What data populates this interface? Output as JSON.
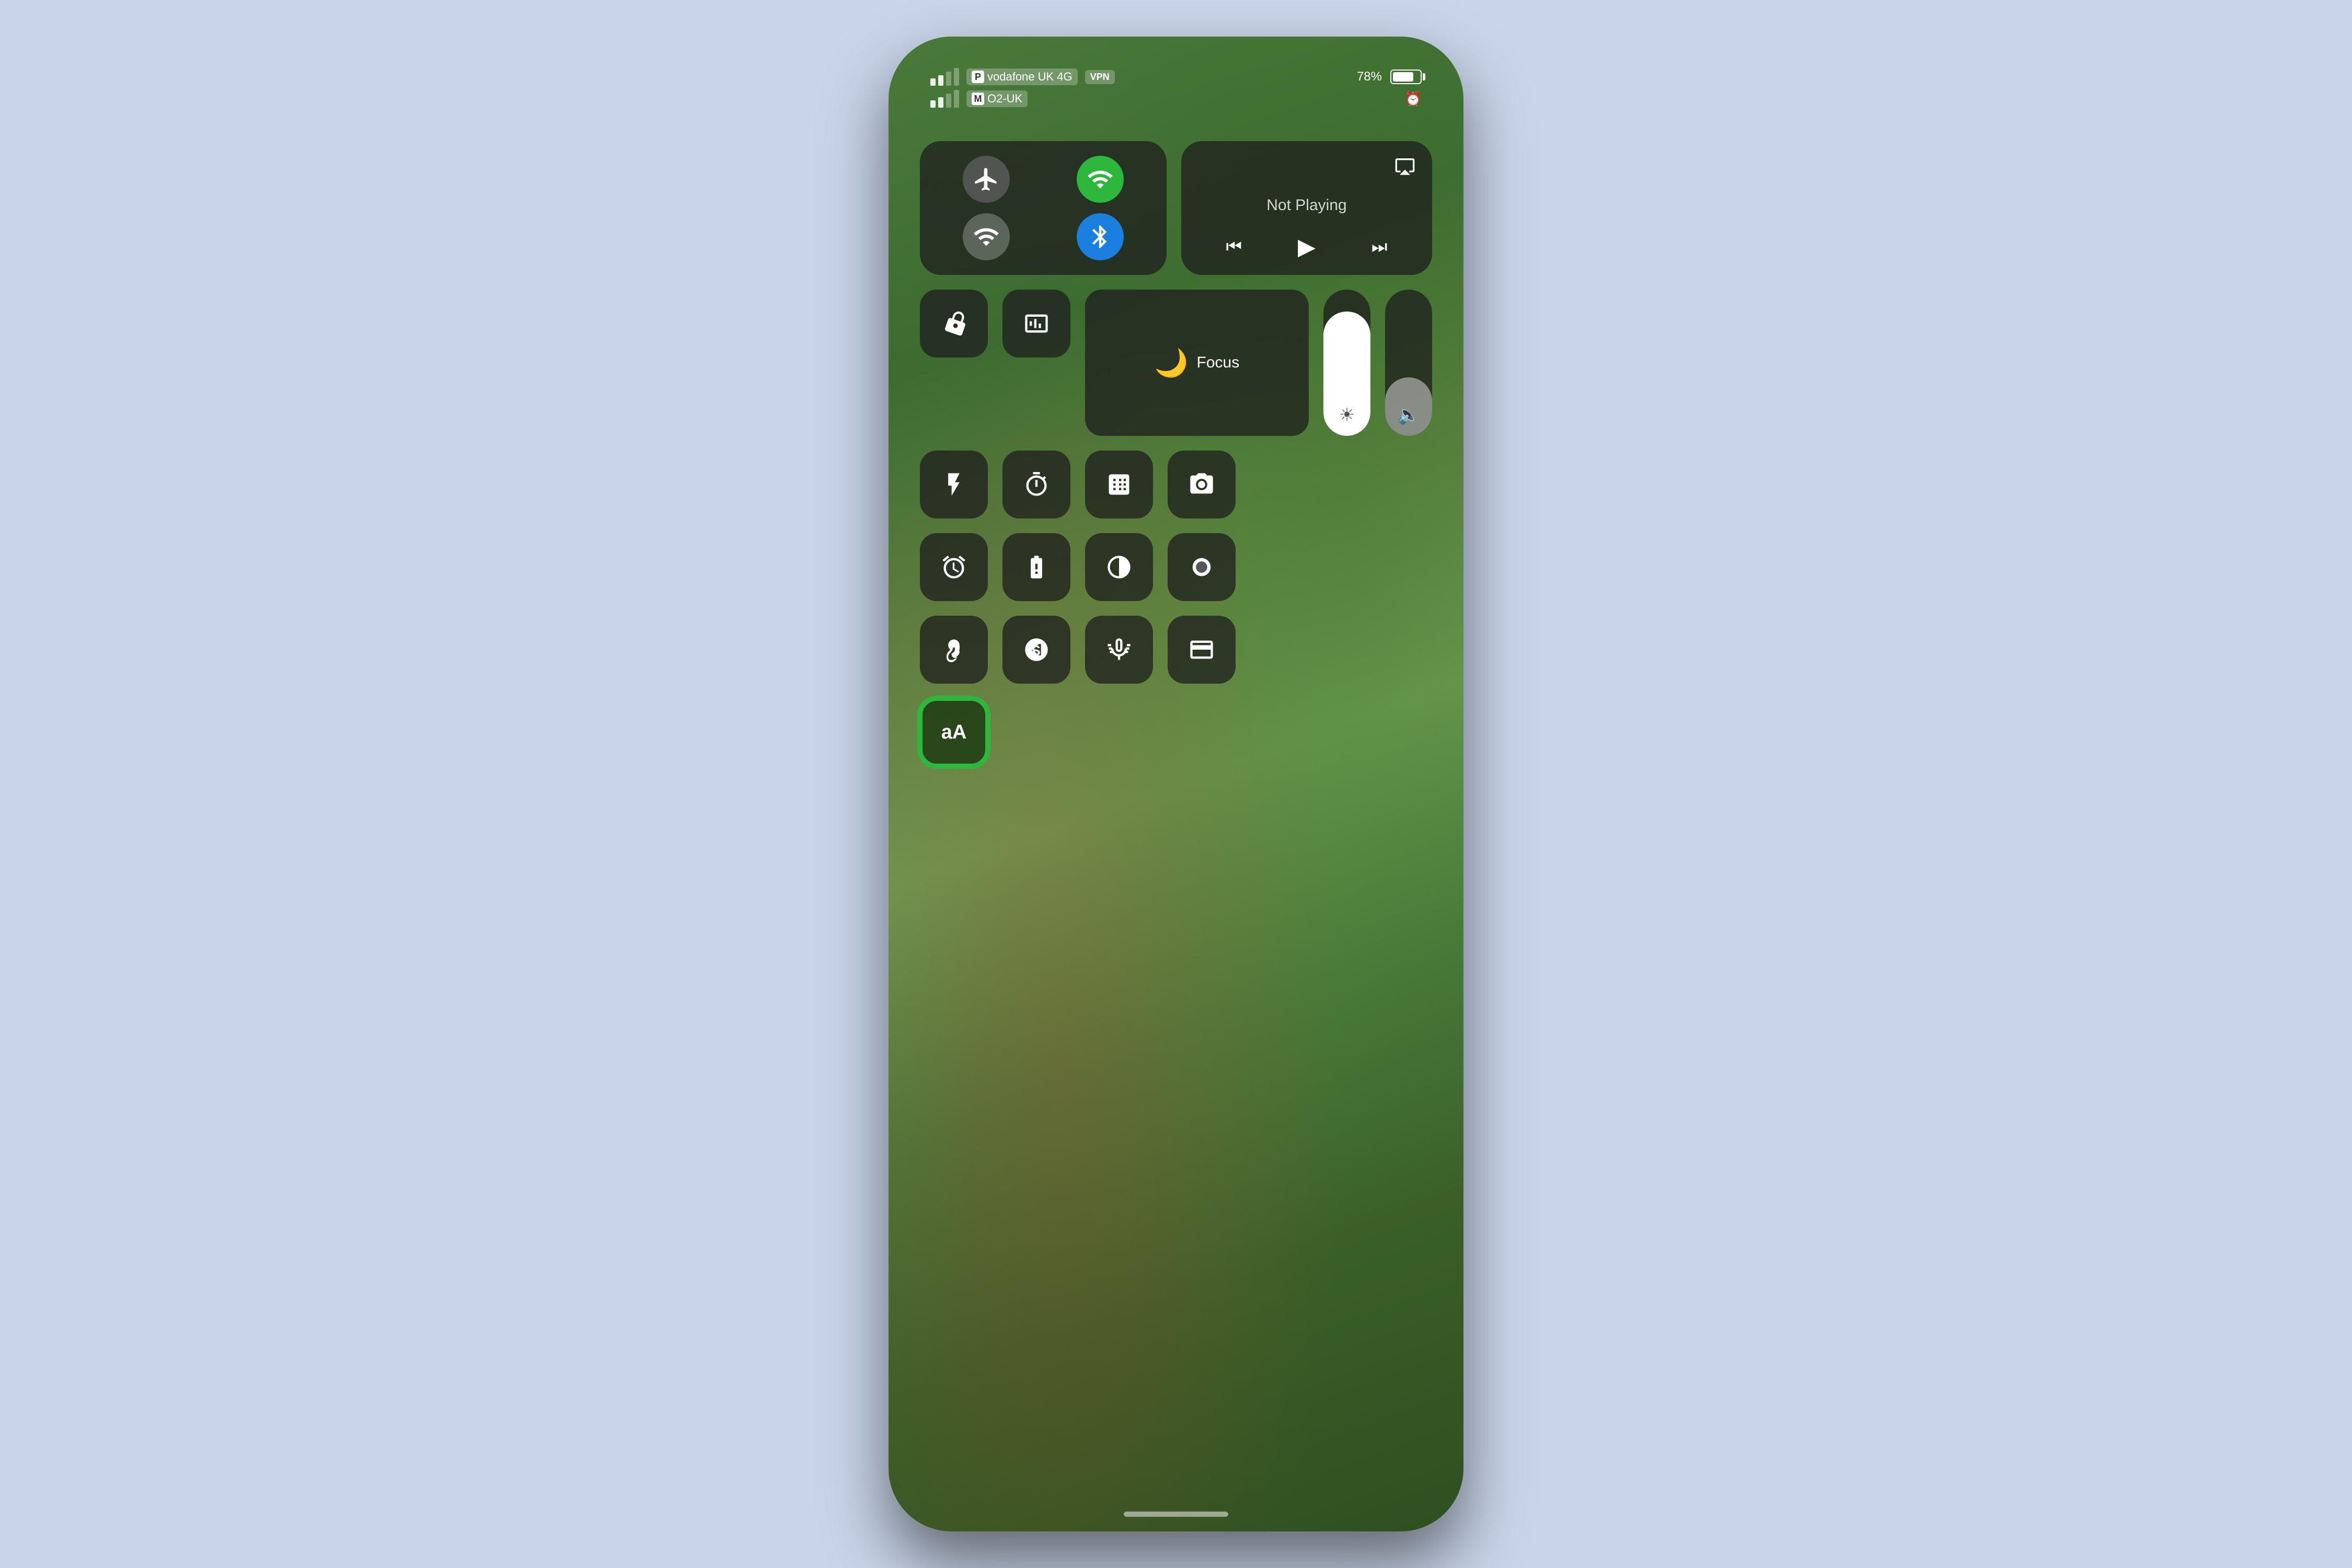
{
  "background_color": "#c8d4e8",
  "status_bar": {
    "row1": {
      "signal1_bars": [
        3,
        3
      ],
      "carrier1_letter": "P",
      "carrier1_name": "vodafone UK 4G",
      "vpn_label": "VPN",
      "battery_pct": "78%",
      "battery_level": 78
    },
    "row2": {
      "carrier2_letter": "M",
      "carrier2_name": "O2-UK",
      "alarm_icon": "⏰"
    }
  },
  "connectivity": {
    "airplane_mode": false,
    "cellular_active": true,
    "wifi_active": true,
    "bluetooth_active": true
  },
  "now_playing": {
    "title": "Not Playing",
    "airplay_label": "airplay",
    "prev_label": "⏮",
    "play_label": "▶",
    "next_label": "⏭"
  },
  "controls": {
    "orientation_lock_label": "orientation-lock",
    "screen_mirror_label": "screen-mirror",
    "focus_label": "Focus",
    "brightness_level": 85,
    "volume_level": 40,
    "flashlight_label": "flashlight",
    "timer_label": "timer",
    "calculator_label": "calculator",
    "camera_label": "camera",
    "alarm_label": "alarm",
    "battery_label": "battery-widget",
    "dark_mode_label": "dark-mode",
    "screen_record_label": "screen-record",
    "hearing_label": "hearing",
    "shazam_label": "shazam",
    "sound_recognition_label": "sound-recognition",
    "wallet_label": "wallet",
    "text_size_label": "aA"
  }
}
